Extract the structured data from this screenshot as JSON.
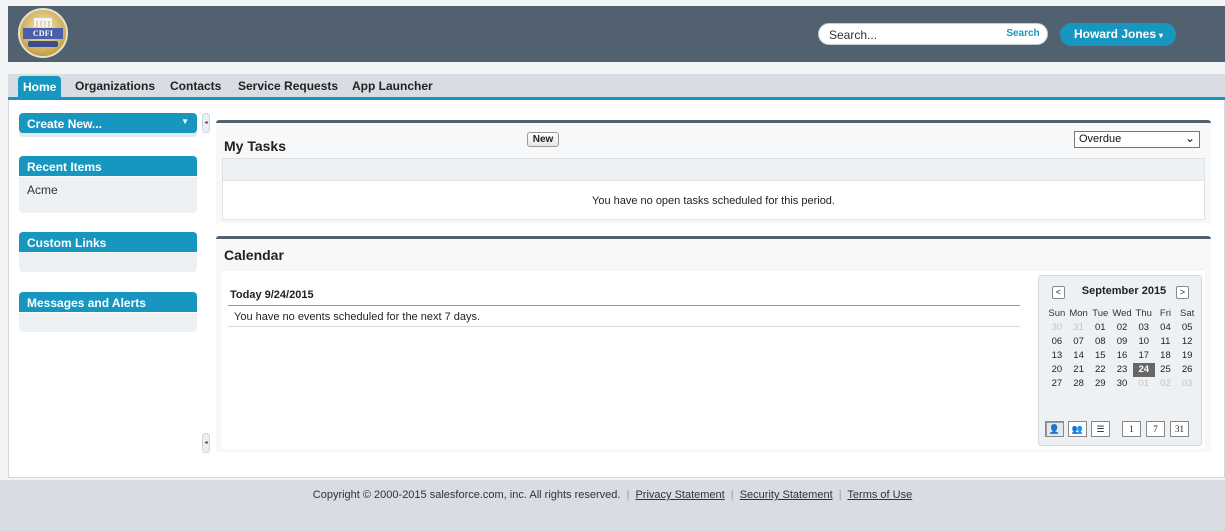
{
  "header": {
    "logo_text": "CDFI FUND",
    "search_placeholder": "Search...",
    "search_button": "Search",
    "user_name": "Howard Jones",
    "user_caret": "▾"
  },
  "tabs": [
    {
      "label": "Home",
      "active": true
    },
    {
      "label": "Organizations"
    },
    {
      "label": "Contacts"
    },
    {
      "label": "Service Requests"
    },
    {
      "label": "App Launcher"
    }
  ],
  "sidebar": {
    "create_new": "Create New...",
    "create_caret": "▼",
    "recent_items_title": "Recent Items",
    "recent_items": [
      "Acme"
    ],
    "custom_links_title": "Custom Links",
    "messages_title": "Messages and Alerts"
  },
  "tasks": {
    "title": "My Tasks",
    "new_button": "New",
    "filter_value": "Overdue",
    "empty_message": "You have no open tasks scheduled for this period."
  },
  "calendar": {
    "title": "Calendar",
    "today_label": "Today 9/24/2015",
    "empty_message": "You have no events scheduled for the next 7 days.",
    "mini": {
      "month_label": "September 2015",
      "prev": "<",
      "next": ">",
      "weekdays": [
        "Sun",
        "Mon",
        "Tue",
        "Wed",
        "Thu",
        "Fri",
        "Sat"
      ],
      "weeks": [
        [
          {
            "d": "30",
            "m": true
          },
          {
            "d": "31",
            "m": true
          },
          {
            "d": "01"
          },
          {
            "d": "02"
          },
          {
            "d": "03"
          },
          {
            "d": "04"
          },
          {
            "d": "05"
          }
        ],
        [
          {
            "d": "06"
          },
          {
            "d": "07"
          },
          {
            "d": "08"
          },
          {
            "d": "09"
          },
          {
            "d": "10"
          },
          {
            "d": "11"
          },
          {
            "d": "12"
          }
        ],
        [
          {
            "d": "13"
          },
          {
            "d": "14"
          },
          {
            "d": "15"
          },
          {
            "d": "16"
          },
          {
            "d": "17"
          },
          {
            "d": "18"
          },
          {
            "d": "19"
          }
        ],
        [
          {
            "d": "20"
          },
          {
            "d": "21"
          },
          {
            "d": "22"
          },
          {
            "d": "23"
          },
          {
            "d": "24",
            "t": true
          },
          {
            "d": "25"
          },
          {
            "d": "26"
          }
        ],
        [
          {
            "d": "27"
          },
          {
            "d": "28"
          },
          {
            "d": "29"
          },
          {
            "d": "30"
          },
          {
            "d": "01",
            "m": true
          },
          {
            "d": "02",
            "m": true
          },
          {
            "d": "03",
            "m": true
          }
        ]
      ],
      "view_buttons": [
        {
          "name": "single-user-view-icon",
          "glyph": "👤",
          "selected": true
        },
        {
          "name": "multi-user-view-icon",
          "glyph": "👥"
        },
        {
          "name": "list-view-icon",
          "glyph": "☰"
        },
        {
          "name": "day-view-button",
          "glyph": "1"
        },
        {
          "name": "week-view-button",
          "glyph": "7"
        },
        {
          "name": "month-view-button",
          "glyph": "31"
        }
      ]
    }
  },
  "footer": {
    "copyright": "Copyright © 2000-2015 salesforce.com, inc. All rights reserved.",
    "links": [
      "Privacy Statement",
      "Security Statement",
      "Terms of Use"
    ]
  },
  "colors": {
    "header_bg": "#52616f",
    "accent": "#1797c0",
    "tabbar_bg": "#d7dde3"
  }
}
